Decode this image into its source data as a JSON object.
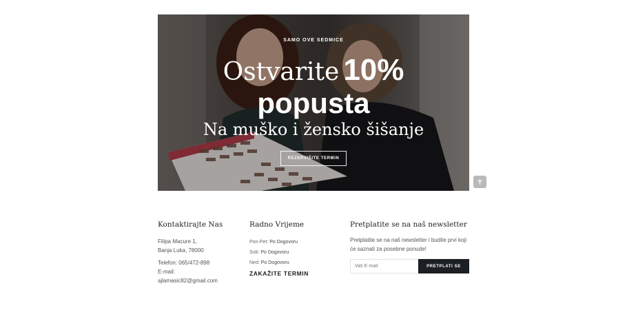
{
  "hero": {
    "eyebrow": "SAMO OVE SEDMICE",
    "headline_serif": "Ostvarite",
    "headline_bold": "10%",
    "headline_line2": "popusta",
    "subheadline": "Na muško i žensko šišanje",
    "cta_label": "REZERVIŠITE TERMIN"
  },
  "scroll_top": {
    "icon": "arrow-up-icon"
  },
  "contact": {
    "title": "Kontaktirajte Nas",
    "address_line1": "Filipa Macure 1,",
    "address_line2": "Banja Luka, 78000",
    "phone": "Telefon: 065/472-898",
    "email_label": "E-mail:",
    "email": "ajlamasic82@gmail.com"
  },
  "hours": {
    "title": "Radno Vrijeme",
    "rows": [
      {
        "day": "Pon-Pet:",
        "value": "Po Dogovoru"
      },
      {
        "day": "Sub:",
        "value": "Po Dogovoru"
      },
      {
        "day": "Ned:",
        "value": "Po Dogovoru"
      }
    ],
    "book_label": "ZAKAŽITE TERMIN"
  },
  "newsletter": {
    "title": "Pretplatite se na naš newsletter",
    "description": "Pretplatite se na naš newsletter i budite prvi koji će saznati za posebne ponude!",
    "input_placeholder": "Vaš E-mail",
    "button_label": "PRETPLATI SE"
  },
  "colors": {
    "dark_button": "#1c1f24",
    "scroll_top_bg": "#b9b9b9"
  }
}
